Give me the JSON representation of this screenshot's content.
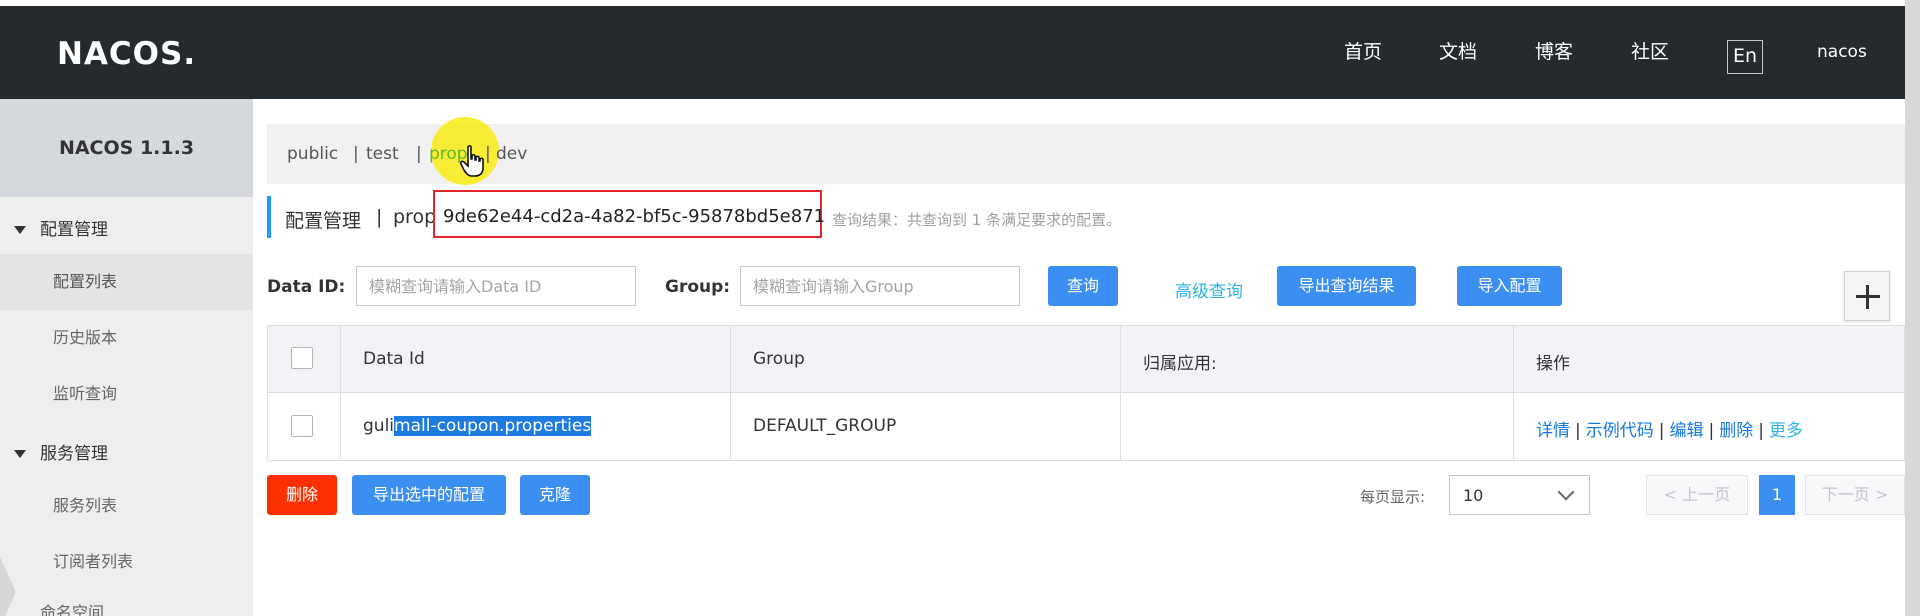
{
  "header": {
    "logo": "NACOS.",
    "nav": [
      "首页",
      "文档",
      "博客",
      "社区"
    ],
    "lang": "En",
    "user": "nacos"
  },
  "sidebar": {
    "version": "NACOS 1.1.3",
    "groups": [
      {
        "label": "配置管理",
        "items": [
          "配置列表",
          "历史版本",
          "监听查询"
        ]
      },
      {
        "label": "服务管理",
        "items": [
          "服务列表",
          "订阅者列表"
        ]
      }
    ],
    "partial_item": "命名空间"
  },
  "namespaces": {
    "items": [
      "public",
      "test",
      "prop",
      "dev"
    ],
    "separator": "|",
    "active": "prop"
  },
  "page": {
    "title": "配置管理",
    "title_sep": "|",
    "namespace_name": "prop",
    "namespace_id": "9de62e44-cd2a-4a82-bf5c-95878bd5e871",
    "result_text": "查询结果：共查询到 1 条满足要求的配置。"
  },
  "search": {
    "dataid_label": "Data ID:",
    "dataid_placeholder": "模糊查询请输入Data ID",
    "group_label": "Group:",
    "group_placeholder": "模糊查询请输入Group",
    "query_button": "查询",
    "advanced_link": "高级查询",
    "export_result_button": "导出查询结果",
    "import_button": "导入配置"
  },
  "table": {
    "columns": [
      "Data Id",
      "Group",
      "归属应用:",
      "操作"
    ],
    "rows": [
      {
        "data_id_prefix": "guli",
        "data_id_selected": "mall-coupon.properties",
        "group": "DEFAULT_GROUP",
        "app": "",
        "actions": [
          "详情",
          "示例代码",
          "编辑",
          "删除",
          "更多"
        ]
      }
    ]
  },
  "footer": {
    "delete_button": "删除",
    "export_selected_button": "导出选中的配置",
    "clone_button": "克隆",
    "page_size_label": "每页显示:",
    "page_size": "10",
    "prev": "< 上一页",
    "current_page": "1",
    "next": "下一页 >"
  },
  "colors": {
    "header_bg": "#252a2f",
    "primary": "#3b8ff0",
    "danger": "#ff3000",
    "highlight_box": "#e4262a",
    "active_namespace": "#5fb827"
  }
}
